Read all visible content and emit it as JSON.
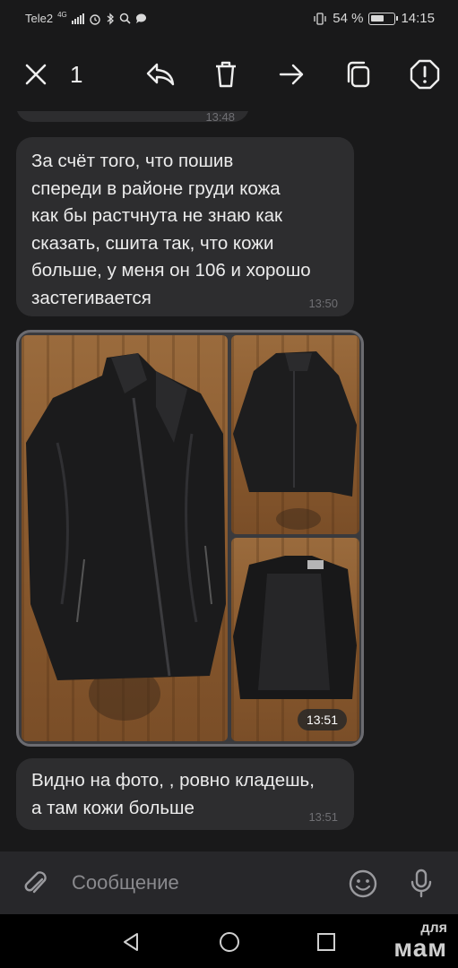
{
  "status_bar": {
    "carrier": "Tele2",
    "network": "4G",
    "battery_percent": "54 %",
    "time": "14:15"
  },
  "action_bar": {
    "selected_count": "1",
    "icons": [
      "close-icon",
      "reply-icon",
      "delete-icon",
      "forward-icon",
      "copy-icon",
      "report-icon"
    ]
  },
  "messages": [
    {
      "text": "За счёт того, что пошив\nспереди в районе груди кожа\nкак бы растчнута не знаю как\nсказать, сшита так, что кожи\nбольше, у меня он 106 и хорошо\nзастегивается",
      "time": "13:50"
    },
    {
      "time": "13:51"
    },
    {
      "text": "Видно на фото, , ровно кладешь,\nа там кожи больше",
      "time": "13:51"
    }
  ],
  "partial_message": {
    "time": "13:48"
  },
  "composer": {
    "placeholder": "Сообщение"
  },
  "watermark": {
    "top": "для",
    "bottom": "мам"
  },
  "colors": {
    "background": "#19191a",
    "bubble": "#2d2d2f",
    "selected_border": "#6b6b70",
    "composer": "#27272a"
  }
}
